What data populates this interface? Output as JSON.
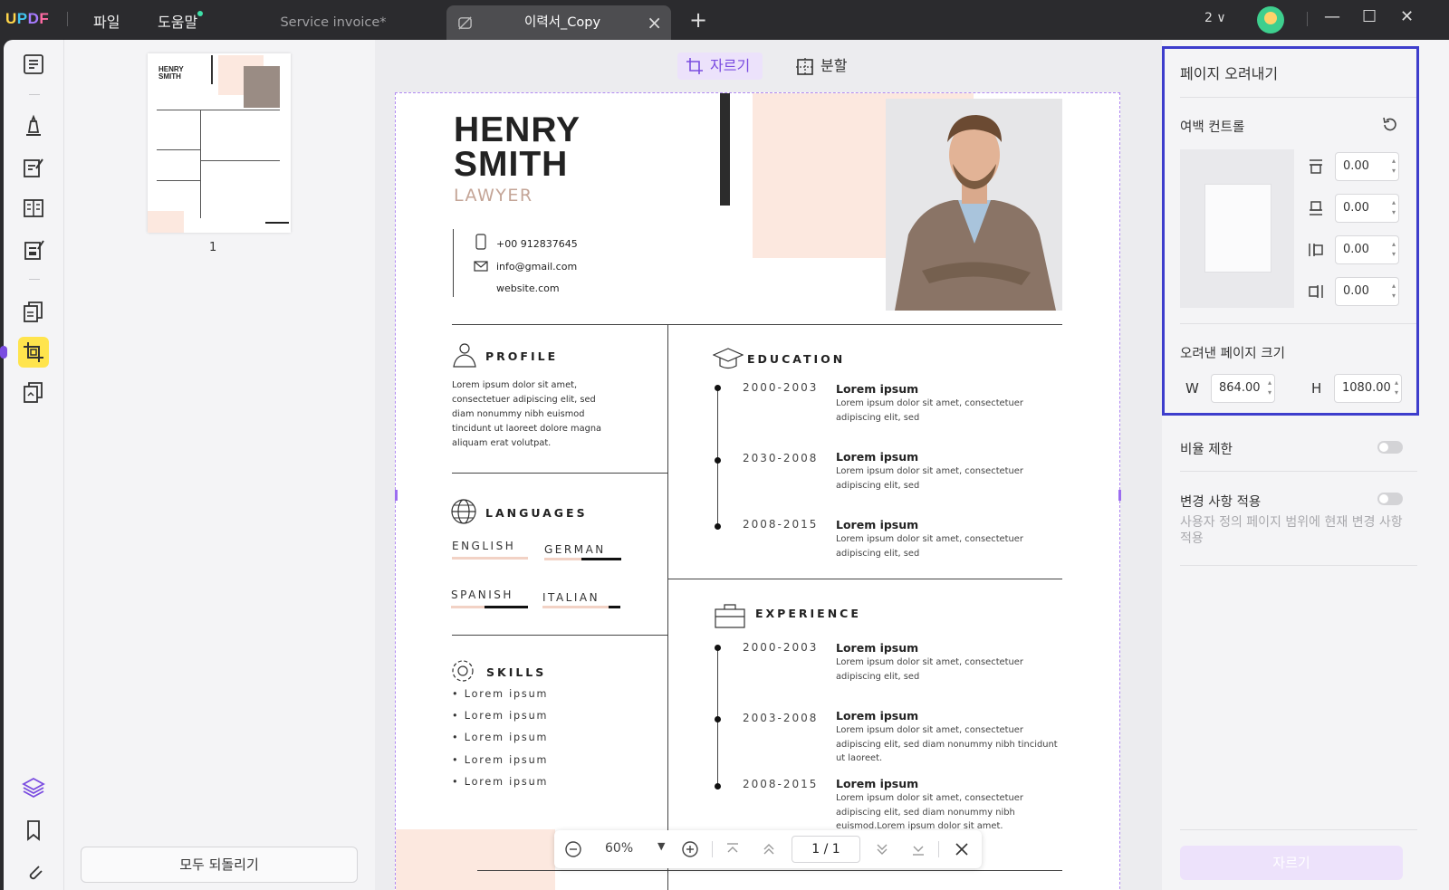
{
  "app": {
    "logo": "UPDF",
    "menu_file": "파일",
    "menu_help": "도움말"
  },
  "tabs": [
    {
      "label": "Service invoice*"
    },
    {
      "label": "이력서_Copy"
    }
  ],
  "window": {
    "page_count": "2 ∨"
  },
  "sidebar": {
    "icons": [
      "reader-icon",
      "comment-icon",
      "edit-pdf-icon",
      "form-icon",
      "sign-icon",
      "organize-icon",
      "crop-icon",
      "convert-icon",
      "layers-icon",
      "bookmark-icon",
      "attachment-icon"
    ],
    "active": "crop-icon"
  },
  "thumbnails": {
    "pages": [
      {
        "num": "1"
      }
    ],
    "reset_all": "모두 되돌리기"
  },
  "toolbar": {
    "crop": "자르기",
    "split": "분할"
  },
  "doc": {
    "first": "HENRY",
    "last": "SMITH",
    "role": "LAWYER",
    "phone": "+00 912837645",
    "email": "info@gmail.com",
    "website": "website.com",
    "profile": {
      "heading": "PROFILE",
      "text": "Lorem ipsum dolor sit amet, consectetuer adipiscing elit, sed diam nonummy nibh euismod tincidunt ut laoreet dolore magna aliquam erat volutpat."
    },
    "languages": {
      "heading": "LANGUAGES",
      "items": [
        {
          "name": "ENGLISH",
          "level": 0
        },
        {
          "name": "GERMAN",
          "level": 0.52
        },
        {
          "name": "SPANISH",
          "level": 0.57
        },
        {
          "name": "ITALIAN",
          "level": 0.15
        }
      ]
    },
    "skills": {
      "heading": "SKILLS",
      "items": [
        "• Lorem ipsum",
        "• Lorem ipsum",
        "• Lorem ipsum",
        "• Lorem ipsum",
        "• Lorem ipsum"
      ]
    },
    "education": {
      "heading": "EDUCATION",
      "items": [
        {
          "years": "2000-2003",
          "title": "Lorem ipsum",
          "text": "Lorem ipsum dolor sit amet, consectetuer adipiscing elit, sed"
        },
        {
          "years": "2030-2008",
          "title": "Lorem ipsum",
          "text": "Lorem ipsum dolor sit amet, consectetuer adipiscing elit, sed"
        },
        {
          "years": "2008-2015",
          "title": "Lorem ipsum",
          "text": "Lorem ipsum dolor sit amet, consectetuer adipiscing elit, sed"
        }
      ]
    },
    "experience": {
      "heading": "EXPERIENCE",
      "items": [
        {
          "years": "2000-2003",
          "title": "Lorem ipsum",
          "text": "Lorem ipsum dolor sit amet, consectetuer adipiscing elit, sed"
        },
        {
          "years": "2003-2008",
          "title": "Lorem ipsum",
          "text": "Lorem ipsum dolor sit amet, consectetuer adipiscing elit, sed diam nonummy nibh tincidunt ut laoreet."
        },
        {
          "years": "2008-2015",
          "title": "Lorem ipsum",
          "text": "Lorem ipsum dolor sit amet, consectetuer adipiscing elit, sed diam nonummy nibh euismod.Lorem ipsum dolor sit amet."
        }
      ]
    }
  },
  "zoom": {
    "level": "60%",
    "page": "1 / 1"
  },
  "crop_panel": {
    "title": "페이지 오려내기",
    "margin_control": "여백 컨트롤",
    "margins": {
      "top": "0.00",
      "bottom": "0.00",
      "left": "0.00",
      "right": "0.00"
    },
    "size_label": "오려낸 페이지 크기",
    "w_label": "W",
    "width": "864.00",
    "h_label": "H",
    "height": "1080.00",
    "ratio_label": "비율 제한",
    "apply_changes_label": "변경 사항 적용",
    "apply_changes_desc": "사용자 정의 페이지 범위에 현재 변경 사항 적용",
    "crop_button": "자르기"
  },
  "colors": {
    "accent": "#7a4ce0",
    "highlight": "#3d3dcc",
    "peach": "#fce8df"
  }
}
